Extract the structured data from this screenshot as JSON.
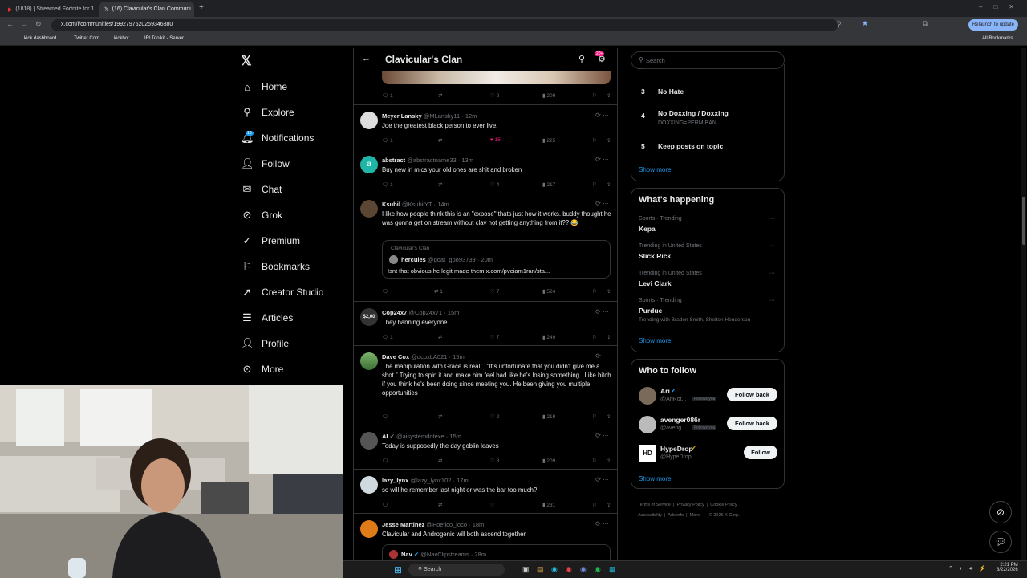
{
  "browser": {
    "tabs": [
      {
        "title": "(1818) | Streamed Fortnite for 1"
      },
      {
        "title": "(16) Clavicular's Clan Communi"
      }
    ],
    "url": "x.com/i/communities/1992797520259346880",
    "bookmarks": [
      "kick dashboard",
      "Twitter Com",
      "kickbot",
      "IRLToolkit - Server"
    ],
    "all_bookmarks": "All Bookmarks",
    "relaunch": "Relaunch to update"
  },
  "nav": {
    "items": [
      "Home",
      "Explore",
      "Notifications",
      "Follow",
      "Chat",
      "Grok",
      "Premium",
      "Bookmarks",
      "Creator Studio",
      "Articles",
      "Profile",
      "More"
    ],
    "notif_badge": "16"
  },
  "feed": {
    "title": "Clavicular's Clan",
    "header_badge": "20+",
    "tweets": [
      {
        "name": "",
        "handle": "",
        "time": "",
        "text": "",
        "stats": {
          "reply": "1",
          "retweet": "",
          "like": "2",
          "views": "209"
        }
      },
      {
        "name": "Meyer Lansky",
        "handle": "@MLansky11",
        "time": "· 12m",
        "text": "Joe the greatest black person to ever live.",
        "stats": {
          "reply": "1",
          "retweet": "",
          "like": "15",
          "views": "225"
        }
      },
      {
        "name": "abstract",
        "handle": "@abstractname33",
        "time": "· 13m",
        "text": "Buy new irl mics your old ones are shit and broken",
        "stats": {
          "reply": "1",
          "retweet": "",
          "like": "4",
          "views": "217"
        }
      },
      {
        "name": "Ksubil",
        "handle": "@KsubilYT",
        "time": "· 14m",
        "text": "I like how people think this is an \"expose\" thats just how it works. buddy thought he was gonna get on stream without clav not getting anything from it?? 😂",
        "stats": {
          "reply": "",
          "retweet": "1",
          "like": "7",
          "views": "524"
        }
      },
      {
        "name": "Cop24x7",
        "handle": "@Cop24x71",
        "time": "· 15m",
        "text": "They banning everyone",
        "stats": {
          "reply": "1",
          "retweet": "",
          "like": "7",
          "views": "249"
        }
      },
      {
        "name": "Dave Cox",
        "handle": "@dcoxLA021",
        "time": "· 15m",
        "text": "The manipulation with Grace is real... \"It's unfortunate that you didn't give me a shot.\" Trying to spin it and make him feel bad like he's losing something.. Like bitch if you think he's been doing since meeting you. He been giving you multiple opportunities",
        "stats": {
          "reply": "",
          "retweet": "",
          "like": "2",
          "views": "219"
        }
      },
      {
        "name": "AI",
        "handle": "@aisystemdotexe",
        "time": "· 15m",
        "text": "Today is supposedly the day goblin leaves",
        "stats": {
          "reply": "",
          "retweet": "",
          "like": "8",
          "views": "209"
        }
      },
      {
        "name": "lazy_lynx",
        "handle": "@lazy_lynx102",
        "time": "· 17m",
        "text": "so will he remember last night or was the bar too much?",
        "stats": {
          "reply": "",
          "retweet": "",
          "like": "",
          "views": "231"
        }
      },
      {
        "name": "Jesse Martinez",
        "handle": "@Poetico_loco",
        "time": "· 18m",
        "text": "Clavicular and Androgenic will both ascend together",
        "stats": {
          "reply": "",
          "retweet": "",
          "like": "",
          "views": ""
        }
      }
    ],
    "quote1": {
      "community": "Clavicular's Clan",
      "name": "hercules",
      "handle": "@goat_gpo93739",
      "time": "· 20m",
      "text": "Isnt that obvious he legit made them x.com/pveiam1ran/sta..."
    },
    "quote2": {
      "name": "Nav",
      "handle": "@NavClipstreams",
      "time": "· 28m"
    },
    "cop_avatar_text": "$2,00"
  },
  "right": {
    "search_placeholder": "Search",
    "rules": [
      {
        "num": "3",
        "title": "No Hate",
        "sub": ""
      },
      {
        "num": "4",
        "title": "No Doxxing / Doxxing",
        "sub": "DOXXING=PERM BAN"
      },
      {
        "num": "5",
        "title": "Keep posts on topic",
        "sub": ""
      }
    ],
    "show_more": "Show more",
    "happening_title": "What's happening",
    "trends": [
      {
        "context": "Sports · Trending",
        "name": "Kepa",
        "extra": ""
      },
      {
        "context": "Trending in United States",
        "name": "Slick Rick",
        "extra": ""
      },
      {
        "context": "Trending in United States",
        "name": "Levi Clark",
        "extra": ""
      },
      {
        "context": "Sports · Trending",
        "name": "Purdue",
        "extra": "Trending with Braden Smith, Shelton Henderson"
      }
    ],
    "wtf_title": "Who to follow",
    "follow": [
      {
        "name": "Ari",
        "handle": "@AriRot...",
        "follows": "Follows you",
        "button": "Follow back"
      },
      {
        "name": "avenger086r",
        "handle": "@aveng...",
        "follows": "Follows you",
        "button": "Follow back"
      },
      {
        "name": "HypeDrop",
        "handle": "@HypeDrop",
        "follows": "",
        "button": "Follow"
      }
    ],
    "footer": [
      "Terms of Service",
      "Privacy Policy",
      "Cookie Policy",
      "Accessibility",
      "Ads info",
      "More ···",
      "© 2026 X Corp."
    ]
  },
  "taskbar": {
    "search": "Search",
    "time": "2:21 PM",
    "date": "3/22/2026"
  },
  "colors": {
    "accent": "#1d9bf0",
    "like": "#f91880",
    "bg": "#000000",
    "border": "#2f3336"
  }
}
